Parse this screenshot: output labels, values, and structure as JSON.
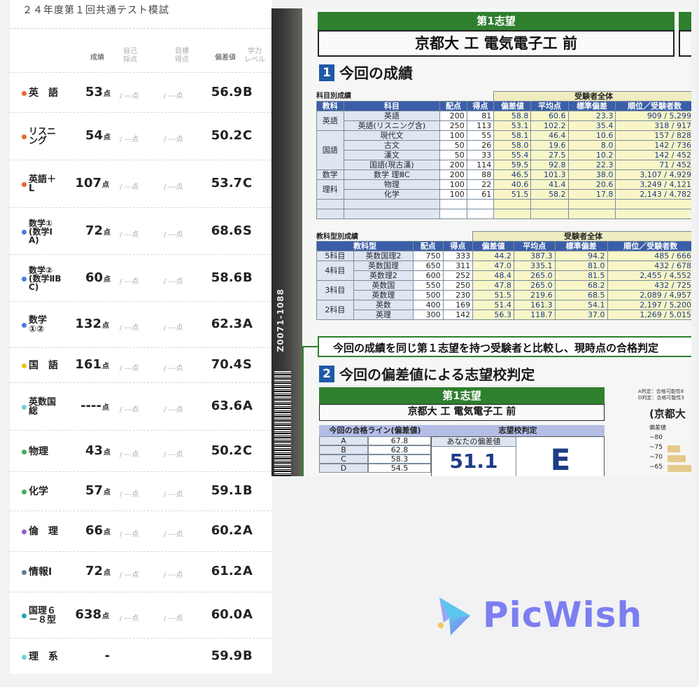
{
  "exam": {
    "title": "２４年度第１回共通テスト模試"
  },
  "header": {
    "score": "成績",
    "self_score": "自己\n採点",
    "target": "目標\n得点",
    "deviation": "偏差値",
    "level": "学力\nレベル"
  },
  "rows": [
    {
      "dot": "#e8682c",
      "subject": "英　語",
      "lines": 1,
      "score": "53",
      "unit": "点",
      "self": "/ ---点",
      "target": "/ ---点",
      "deviation": "56.9",
      "level": "B"
    },
    {
      "dot": "#e8682c",
      "subject": "リスニ\nング",
      "lines": 2,
      "score": "54",
      "unit": "点",
      "self": "/ ---点",
      "target": "/ ---点",
      "deviation": "50.2",
      "level": "C"
    },
    {
      "dot": "#e8682c",
      "subject": "英語＋\nL",
      "lines": 2,
      "score": "107",
      "unit": "点",
      "self": "/ ---点",
      "target": "/ ---点",
      "deviation": "53.7",
      "level": "C"
    },
    {
      "dot": "#4a7be0",
      "subject": "数学①\n(数学Ⅰ\nA)",
      "lines": 3,
      "score": "72",
      "unit": "点",
      "self": "/ ---点",
      "target": "/ ---点",
      "deviation": "68.6",
      "level": "S"
    },
    {
      "dot": "#4a7be0",
      "subject": "数学②\n(数学ⅡB\nC)",
      "lines": 3,
      "score": "60",
      "unit": "点",
      "self": "/ ---点",
      "target": "/ ---点",
      "deviation": "58.6",
      "level": "B"
    },
    {
      "dot": "#4a7be0",
      "subject": "数学\n①②",
      "lines": 2,
      "score": "132",
      "unit": "点",
      "self": "/ ---点",
      "target": "/ ---点",
      "deviation": "62.3",
      "level": "A"
    },
    {
      "dot": "#f0c419",
      "subject": "国　語",
      "lines": 1,
      "score": "161",
      "unit": "点",
      "self": "/ ---点",
      "target": "/ ---点",
      "deviation": "70.4",
      "level": "S"
    },
    {
      "dot": "#6fd0d0",
      "subject": "英数国\n総",
      "lines": 2,
      "score": "----",
      "unit": "点",
      "self": "/ ---点",
      "target": "/ ---点",
      "deviation": "63.6",
      "level": "A"
    },
    {
      "dot": "#3db15a",
      "subject": "物理",
      "lines": 1,
      "score": "43",
      "unit": "点",
      "self": "/ ---点",
      "target": "/ ---点",
      "deviation": "50.2",
      "level": "C"
    },
    {
      "dot": "#3db15a",
      "subject": "化学",
      "lines": 1,
      "score": "57",
      "unit": "点",
      "self": "/ ---点",
      "target": "/ ---点",
      "deviation": "59.1",
      "level": "B"
    },
    {
      "dot": "#8f5fd6",
      "subject": "倫　理",
      "lines": 1,
      "score": "66",
      "unit": "点",
      "self": "/ ---点",
      "target": "/ ---点",
      "deviation": "60.2",
      "level": "A"
    },
    {
      "dot": "#5e7f8f",
      "subject": "情報Ⅰ",
      "lines": 1,
      "score": "72",
      "unit": "点",
      "self": "/ ---点",
      "target": "/ ---点",
      "deviation": "61.2",
      "level": "A"
    },
    {
      "dot": "#23a6b8",
      "subject": "国理６\n－８型",
      "lines": 2,
      "score": "638",
      "unit": "点",
      "self": "/ ---点",
      "target": "/ ---点",
      "deviation": "60.0",
      "level": "A"
    },
    {
      "dot": "#6fd0e0",
      "subject": "理　系",
      "lines": 1,
      "score": "-",
      "unit": "",
      "self": "",
      "target": "",
      "deviation": "59.9",
      "level": "B"
    }
  ],
  "report": {
    "first_choice_label": "第1志望",
    "first_choice_name": "京都大 工 電気電子工 前",
    "sec1_num": "1",
    "sec1_title": "今回の成績",
    "subj_table_label": "科目別成績",
    "all_examinees": "受験者全体",
    "cols1": [
      "教科",
      "科目",
      "配点",
      "得点",
      "偏差値",
      "平均点",
      "標準偏差",
      "順位／受験者数"
    ],
    "subjects": [
      {
        "group": "英語",
        "name": "英語",
        "max": "200",
        "score": "81",
        "dev": "58.8",
        "avg": "60.6",
        "sd": "23.3",
        "rank": "909 / 5,299"
      },
      {
        "group": "",
        "name": "英語(リスニング含)",
        "max": "250",
        "score": "113",
        "dev": "53.1",
        "avg": "102.2",
        "sd": "35.4",
        "rank": "318 / 917"
      },
      {
        "group": "国語",
        "name": "現代文",
        "max": "100",
        "score": "55",
        "dev": "58.1",
        "avg": "46.4",
        "sd": "10.6",
        "rank": "157 / 828"
      },
      {
        "group": "",
        "name": "古文",
        "max": "50",
        "score": "26",
        "dev": "58.0",
        "avg": "19.6",
        "sd": "8.0",
        "rank": "142 / 736"
      },
      {
        "group": "",
        "name": "漢文",
        "max": "50",
        "score": "33",
        "dev": "55.4",
        "avg": "27.5",
        "sd": "10.2",
        "rank": "142 / 452"
      },
      {
        "group": "",
        "name": "国語(現古漢)",
        "max": "200",
        "score": "114",
        "dev": "59.5",
        "avg": "92.8",
        "sd": "22.3",
        "rank": "71 / 452"
      },
      {
        "group": "数学",
        "name": "数学 理ⅢC",
        "max": "200",
        "score": "88",
        "dev": "46.5",
        "avg": "101.3",
        "sd": "38.0",
        "rank": "3,107 / 4,929"
      },
      {
        "group": "理科",
        "name": "物理",
        "max": "100",
        "score": "22",
        "dev": "40.6",
        "avg": "41.4",
        "sd": "20.6",
        "rank": "3,249 / 4,121"
      },
      {
        "group": "",
        "name": "化学",
        "max": "100",
        "score": "61",
        "dev": "51.5",
        "avg": "58.2",
        "sd": "17.8",
        "rank": "2,143 / 4,782"
      }
    ],
    "type_table_label": "教科型別成績",
    "cols2": [
      "教科型",
      "配点",
      "得点",
      "偏差値",
      "平均点",
      "標準偏差",
      "順位／受験者数"
    ],
    "types": [
      {
        "group": "5科目",
        "name": "英数国理2",
        "max": "750",
        "score": "333",
        "dev": "44.2",
        "avg": "387.3",
        "sd": "94.2",
        "rank": "485 / 666"
      },
      {
        "group": "4科目",
        "name": "英数国理",
        "max": "650",
        "score": "311",
        "dev": "47.0",
        "avg": "335.1",
        "sd": "81.0",
        "rank": "432 / 678"
      },
      {
        "group": "",
        "name": "英数理2",
        "max": "600",
        "score": "252",
        "dev": "48.4",
        "avg": "265.0",
        "sd": "81.5",
        "rank": "2,455 / 4,552"
      },
      {
        "group": "3科目",
        "name": "英数国",
        "max": "550",
        "score": "250",
        "dev": "47.8",
        "avg": "265.0",
        "sd": "68.2",
        "rank": "432 / 725"
      },
      {
        "group": "",
        "name": "英数理",
        "max": "500",
        "score": "230",
        "dev": "51.5",
        "avg": "219.6",
        "sd": "68.5",
        "rank": "2,089 / 4,957"
      },
      {
        "group": "2科目",
        "name": "英数",
        "max": "400",
        "score": "169",
        "dev": "51.4",
        "avg": "161.3",
        "sd": "54.1",
        "rank": "2,197 / 5,200"
      },
      {
        "group": "",
        "name": "英理",
        "max": "300",
        "score": "142",
        "dev": "56.3",
        "avg": "118.7",
        "sd": "37.0",
        "rank": "1,269 / 5,015"
      }
    ],
    "code": "Z0071-1088",
    "compare_text": "今回の成績を同じ第１志望を持つ受験者と比較し、現時点の合格判定",
    "sec2_num": "2",
    "sec2_title": "今回の偏差値による志望校判定",
    "judge_first_choice": "第1志望",
    "judge_name": "京都大 工 電気電子工 前",
    "pass_line_label": "今回の合格ライン(偏差値)",
    "judge_label": "志望校判定",
    "your_dev_label": "あなたの偏差値",
    "pass_lines": [
      {
        "grade": "A",
        "value": "67.8"
      },
      {
        "grade": "B",
        "value": "62.8"
      },
      {
        "grade": "C",
        "value": "58.3"
      },
      {
        "grade": "D",
        "value": "54.5"
      }
    ],
    "your_dev": "51.1",
    "verdict": "E",
    "legend_a": "A判定：合格可能性8",
    "legend_d": "D判定：合格可能性3",
    "side_name": "(京都大",
    "ladder_title": "偏差値",
    "ladder": [
      "~80",
      "~75",
      "~70",
      "~65"
    ]
  },
  "brand": {
    "name": "PicWish",
    "color": "#7b7ff0"
  }
}
